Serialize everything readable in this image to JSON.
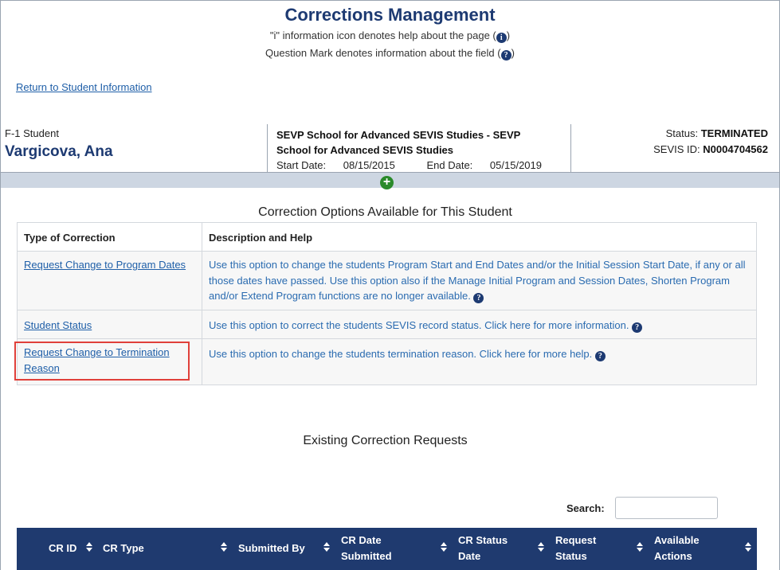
{
  "header": {
    "title": "Corrections Management",
    "info_line_prefix": "\"i\" information icon denotes help about the page (",
    "info_line_suffix": ")",
    "question_line_prefix": "Question Mark denotes information about the field (",
    "question_line_suffix": ")"
  },
  "nav": {
    "return_link": "Return to Student Information"
  },
  "student": {
    "type": "F-1 Student",
    "name": "Vargicova, Ana",
    "school": "SEVP School for Advanced SEVIS Studies - SEVP School for Advanced SEVIS Studies",
    "start_label": "Start Date:",
    "start_date": "08/15/2015",
    "end_label": "End Date:",
    "end_date": "05/15/2019",
    "status_label": "Status:",
    "status": "TERMINATED",
    "sevis_label": "SEVIS ID:",
    "sevis_id": "N0004704562"
  },
  "options": {
    "title": "Correction Options Available for This Student",
    "headers": [
      "Type of Correction",
      "Description and Help"
    ],
    "rows": [
      {
        "type": "Request Change to Program Dates",
        "desc": "Use this option to change the students Program Start and End Dates and/or the Initial Session Start Date, if any or all those dates have passed. Use this option also if the Manage Initial Program and Session Dates, Shorten Program and/or Extend Program functions are no longer available."
      },
      {
        "type": "Student Status",
        "desc": "Use this option to correct the students SEVIS record status. Click here for more information."
      },
      {
        "type": "Request Change to Termination Reason",
        "desc": "Use this option to change the students termination reason. Click here for more help."
      }
    ]
  },
  "existing": {
    "title": "Existing Correction Requests",
    "search_label": "Search:",
    "search_value": "",
    "columns": [
      "CR ID",
      "CR Type",
      "Submitted By",
      "CR Date Submitted",
      "CR Status Date",
      "Request Status",
      "Available Actions"
    ]
  },
  "icons": {
    "info": "info-icon",
    "help": "question-icon",
    "add": "plus-circle-icon",
    "sort": "sort-icon"
  },
  "colors": {
    "brand_navy": "#1d3a72",
    "link_blue": "#1f5fa8",
    "highlight_red": "#e0403a",
    "add_green": "#2a8a2a",
    "grid_header": "#1f3a6f"
  }
}
